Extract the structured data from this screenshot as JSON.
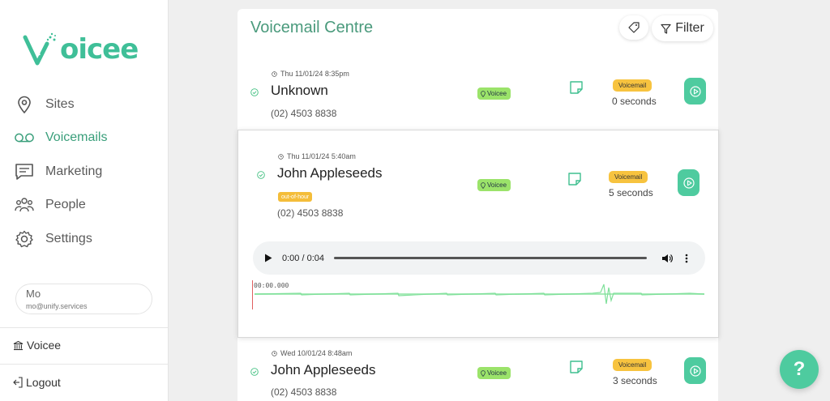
{
  "brand": {
    "logo_text": "oicee",
    "accent": "#3fbf98"
  },
  "sidebar": {
    "items": [
      {
        "label": "Sites",
        "icon": "map-pin-icon"
      },
      {
        "label": "Voicemails",
        "icon": "voicemail-icon",
        "active": true
      },
      {
        "label": "Marketing",
        "icon": "message-icon"
      },
      {
        "label": "People",
        "icon": "people-icon"
      },
      {
        "label": "Settings",
        "icon": "gear-icon"
      }
    ],
    "user": {
      "name": "Mo",
      "email": "mo@unify.services"
    },
    "org_label": "Voicee",
    "logout_label": "Logout"
  },
  "main": {
    "title": "Voicemail Centre",
    "filter_label": "Filter",
    "voicemails": [
      {
        "timestamp": "Thu 11/01/24 8:35pm",
        "name": "Unknown",
        "phone": "(02) 4503 8838",
        "site": "Voicee",
        "type": "Voicemail",
        "duration": "0 seconds"
      },
      {
        "timestamp": "Thu 11/01/24 5:40am",
        "name": "John Appleseeds",
        "phone": "(02) 4503 8838",
        "site": "Voicee",
        "type": "Voicemail",
        "duration": "5 seconds",
        "tag": "out-of-hour"
      },
      {
        "timestamp": "Wed 10/01/24 8:48am",
        "name": "John Appleseeds",
        "phone": "(02) 4503 8838",
        "site": "Voicee",
        "type": "Voicemail",
        "duration": "3 seconds"
      }
    ],
    "player": {
      "time": "0:00 / 0:04",
      "waveform_time": "00:00.000"
    }
  },
  "help_label": "?"
}
